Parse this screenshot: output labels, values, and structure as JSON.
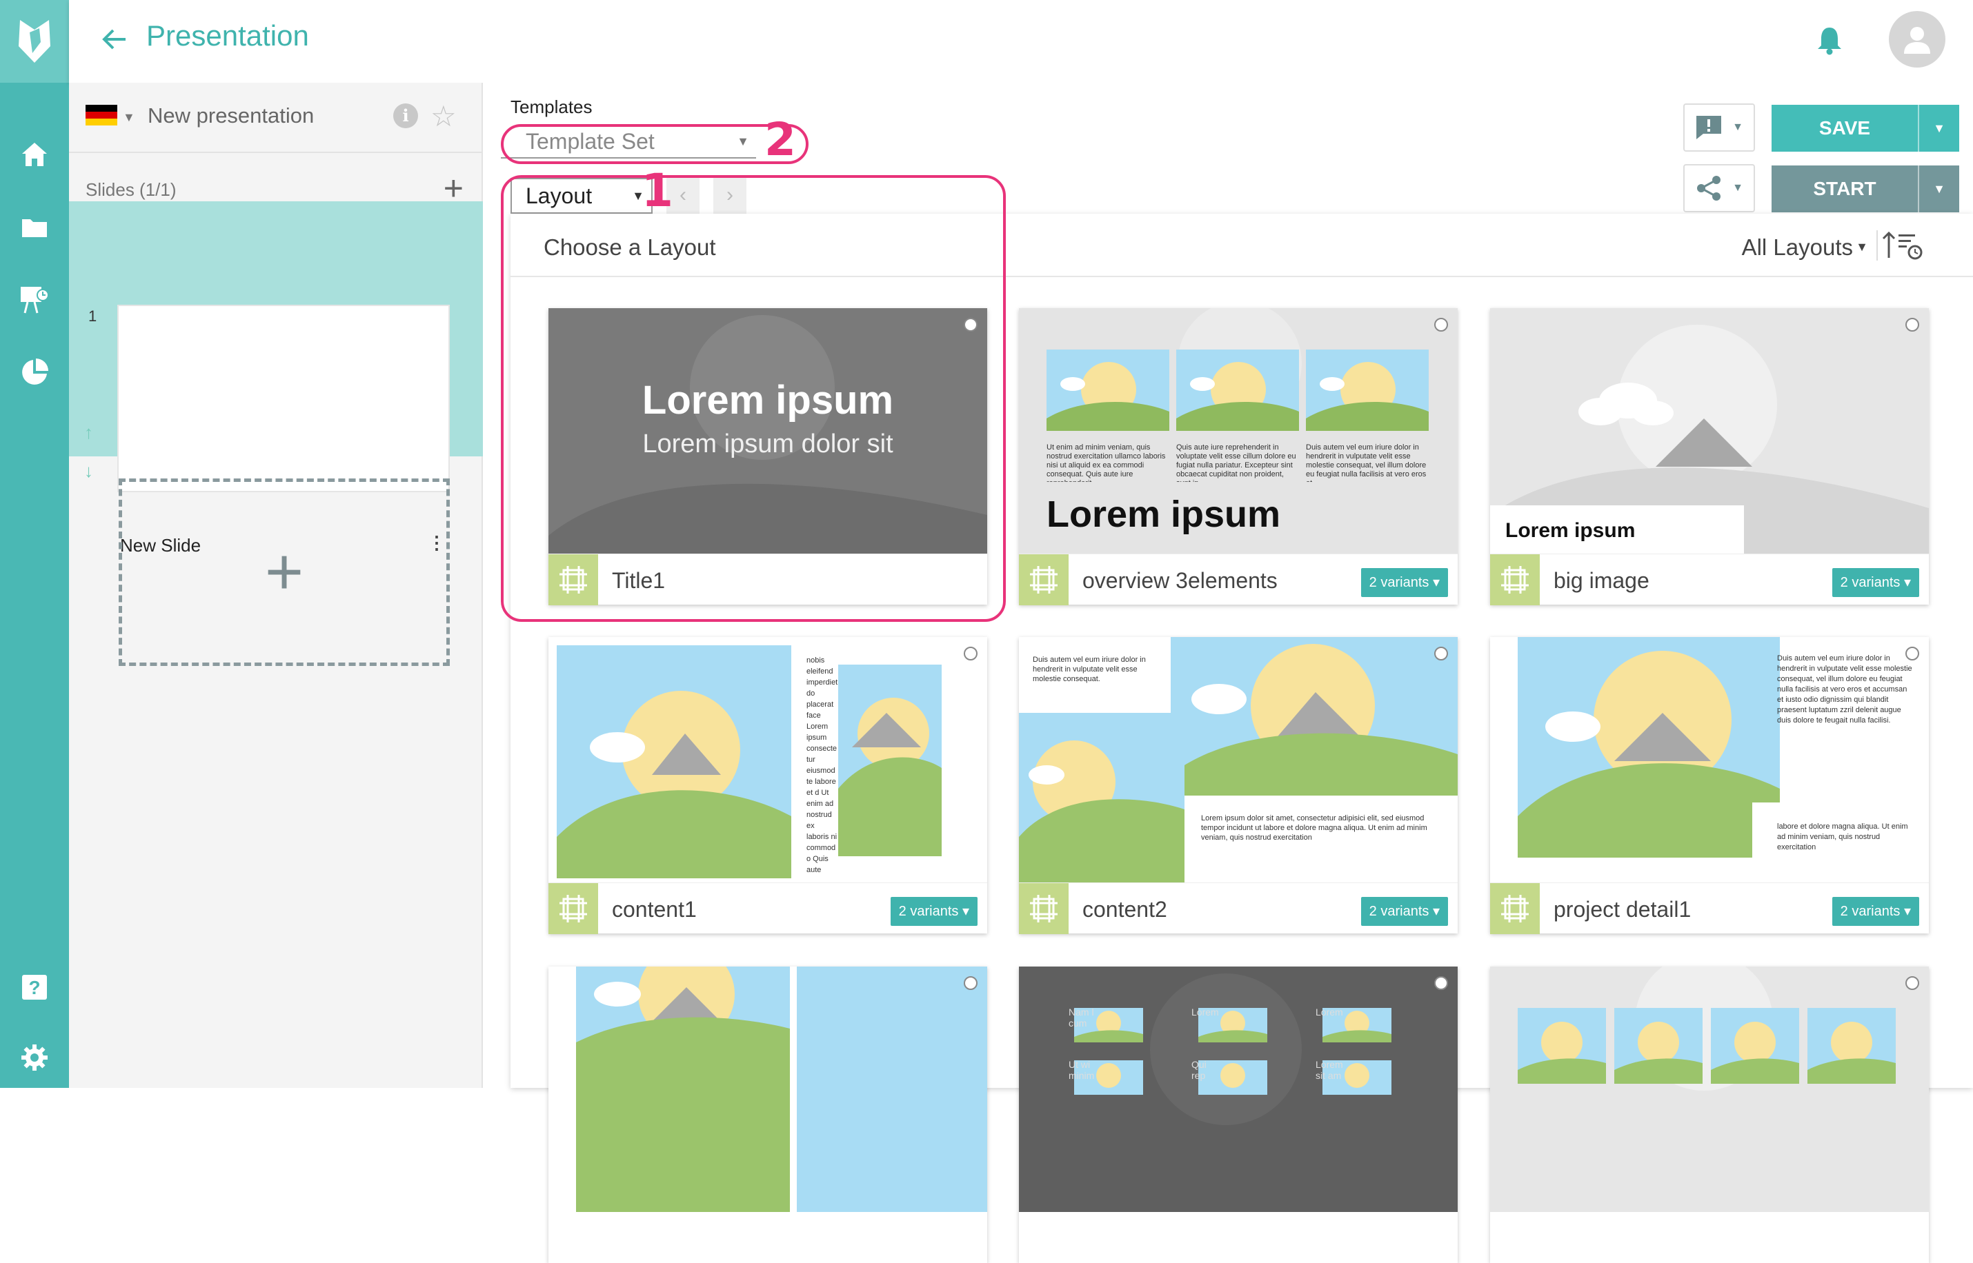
{
  "app": {
    "title": "Presentation"
  },
  "colors": {
    "teal": "#4ab8b4",
    "accent": "#3fb3ad",
    "save_btn": "#44bdb8",
    "start_btn": "#74979b",
    "annotation": "#e8337a",
    "thumb_green": "#c4d98a"
  },
  "icons": [
    "home-icon",
    "folder-icon",
    "presentation-icon",
    "pie-chart-icon",
    "help-icon",
    "gear-icon",
    "bell-icon",
    "user-avatar-icon",
    "arrow-left-icon",
    "star-icon",
    "info-icon",
    "comment-icon",
    "share-icon",
    "sort-icon",
    "layout-grid-icon"
  ],
  "presentation": {
    "name": "New presentation",
    "language_flag": "germany-flag-icon"
  },
  "slides": {
    "header": "Slides (1/1)",
    "items": [
      {
        "number": "1",
        "name": "New Slide"
      }
    ]
  },
  "templates": {
    "label": "Templates",
    "template_set_placeholder": "Template Set",
    "layout_select": "Layout"
  },
  "buttons": {
    "save": "SAVE",
    "start": "START"
  },
  "picker": {
    "title": "Choose a Layout",
    "filter": "All Layouts"
  },
  "layouts": [
    {
      "name": "Title1",
      "variants": "",
      "headline": "Lorem ipsum",
      "subline": "Lorem ipsum dolor sit"
    },
    {
      "name": "overview 3elements",
      "variants": "2 variants",
      "headline": "Lorem ipsum",
      "col1": "Ut enim ad minim veniam, quis nostrud exercitation ullamco laboris nisi ut aliquid ex ea commodi consequat. Quis aute iure reprehenderit",
      "col2": "Quis aute iure reprehenderit in voluptate velit esse cillum dolore eu fugiat nulla pariatur. Excepteur sint obcaecat cupiditat non proident, sunt in",
      "col3": "Duis autem vel eum iriure dolor in hendrerit in vulputate velit esse molestie consequat, vel illum dolore eu feugiat nulla facilisis at vero eros et"
    },
    {
      "name": "big image",
      "variants": "2 variants",
      "caption": "Lorem ipsum"
    },
    {
      "name": "content1",
      "variants": "2 variants",
      "side_text": "nobis eleifend imperdiet do placerat face Lorem ipsum consectetur eiusmod te labore et d Ut enim ad nostrud ex laboris ni commodo Quis aute voluptate eu fugiat Excepteur non pr"
    },
    {
      "name": "content2",
      "variants": "2 variants",
      "top_text": "Duis autem vel eum iriure dolor in hendrerit in vulputate velit esse molestie consequat.",
      "bottom_text": "Lorem ipsum dolor sit amet, consectetur adipisici elit, sed eiusmod tempor incidunt ut labore et dolore magna aliqua. Ut enim ad minim veniam, quis nostrud exercitation"
    },
    {
      "name": "project detail1",
      "variants": "2 variants",
      "side_text": "Duis autem vel eum iriure dolor in hendrerit in vulputate velit esse molestie consequat, vel illum dolore eu feugiat nulla facilisis at vero eros et accumsan et iusto odio dignissim qui blandit praesent luptatum zzril delenit augue duis dolore te feugait nulla facilisi.",
      "bottom_text": "labore et dolore magna aliqua. Ut enim ad minim veniam, quis nostrud exercitation"
    },
    {
      "name": "",
      "variants": ""
    },
    {
      "name": "",
      "variants": "",
      "grid_labels": [
        "Nam l",
        "cum",
        "Ut wi",
        "minim",
        "Lorem",
        "Qui",
        "rep",
        "Lorem",
        "Lorem",
        "sit am"
      ]
    },
    {
      "name": "",
      "variants": ""
    }
  ],
  "annotations": [
    "1",
    "2"
  ]
}
